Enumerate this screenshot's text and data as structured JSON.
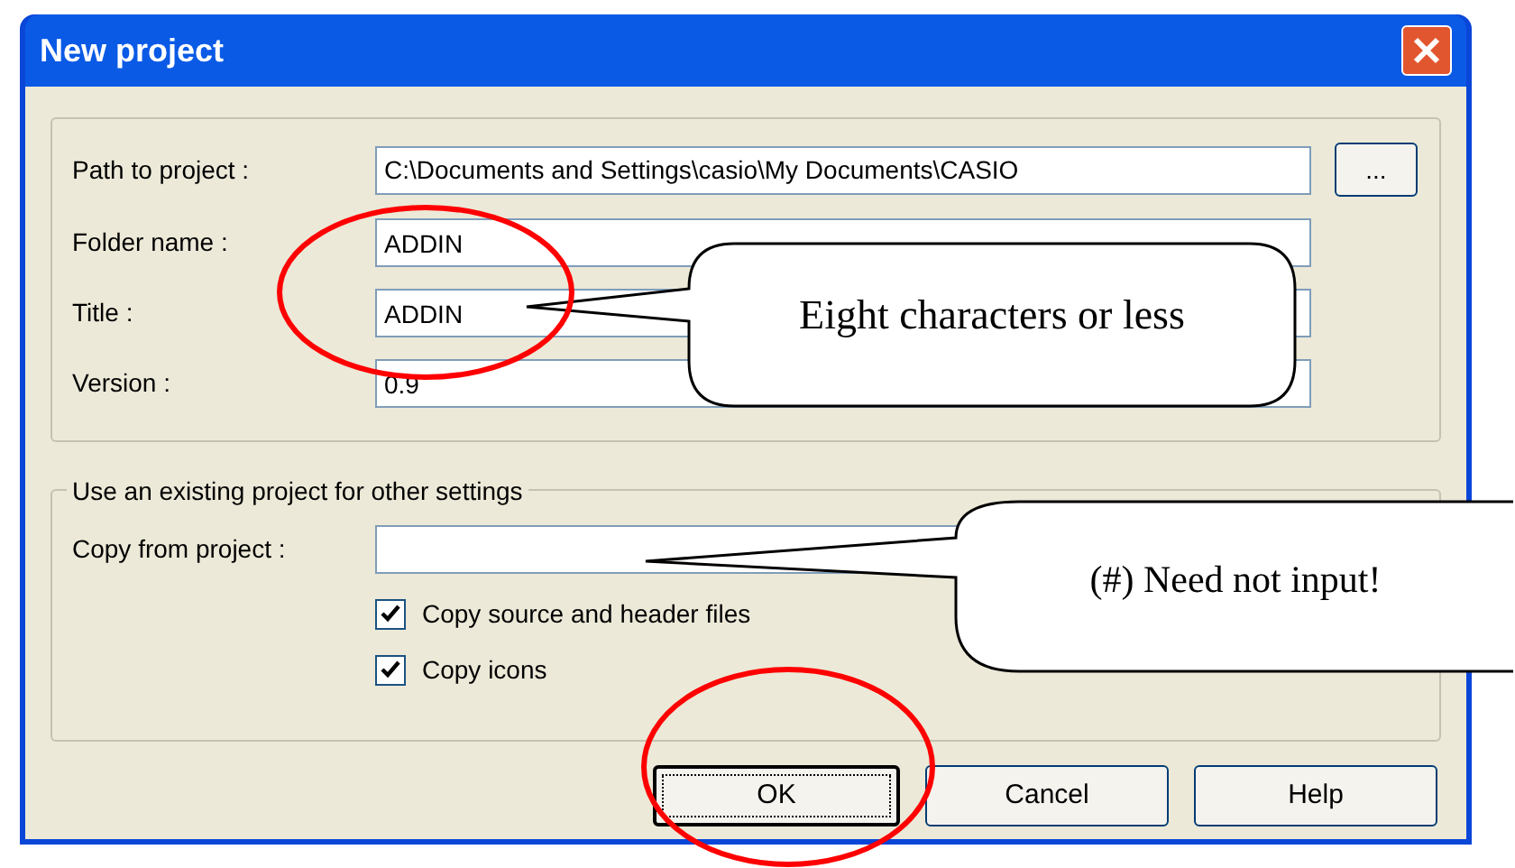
{
  "window": {
    "title": "New project"
  },
  "project_fields": [
    {
      "label": "Path to project :",
      "value": "C:\\Documents and Settings\\casio\\My Documents\\CASIO",
      "browse": "..."
    },
    {
      "label": "Folder name :",
      "value": "ADDIN"
    },
    {
      "label": "Title :",
      "value": "ADDIN"
    },
    {
      "label": "Version :",
      "value": "0.9"
    }
  ],
  "existing_project": {
    "legend": "Use an existing project for other settings",
    "copy_label": "Copy from project :",
    "options": [
      {
        "label": "Copy source and header files",
        "checked": true
      },
      {
        "label": "Copy icons",
        "checked": true
      }
    ]
  },
  "buttons": [
    {
      "label": "OK",
      "focused": true
    },
    {
      "label": "Cancel",
      "focused": false
    },
    {
      "label": "Help",
      "focused": false
    }
  ],
  "callouts": [
    {
      "text": "Eight characters or less"
    },
    {
      "text": "(#) Need not input!"
    }
  ]
}
